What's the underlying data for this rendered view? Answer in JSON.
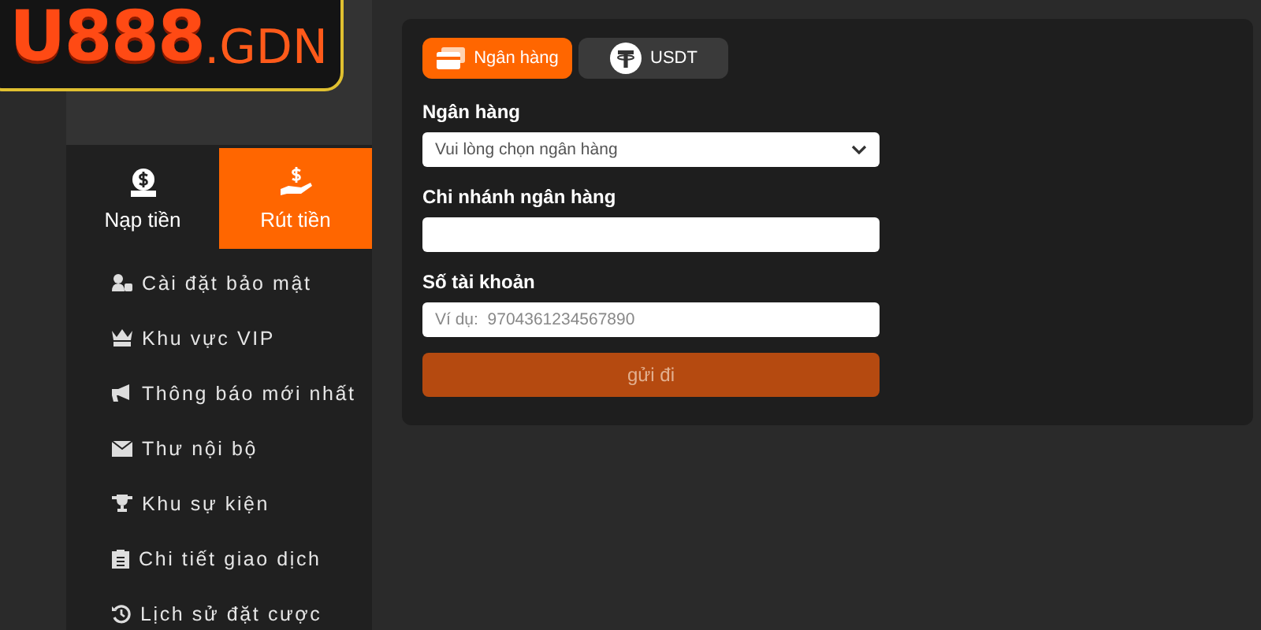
{
  "logo": {
    "main": "U888",
    "suffix": ".GDN"
  },
  "wallet_tabs": [
    {
      "label": "Nạp tiền",
      "kind": "deposit",
      "selected": false
    },
    {
      "label": "Rút tiền",
      "kind": "withdraw",
      "selected": true
    }
  ],
  "menu": [
    {
      "label": "Cài đặt bảo mật",
      "kind": "security"
    },
    {
      "label": "Khu vực VIP",
      "kind": "vip"
    },
    {
      "label": "Thông báo mới nhất",
      "kind": "news"
    },
    {
      "label": "Thư nội bộ",
      "kind": "mail"
    },
    {
      "label": "Khu sự kiện",
      "kind": "events"
    },
    {
      "label": "Chi tiết giao dịch",
      "kind": "transactions"
    },
    {
      "label": "Lịch sử đặt cược",
      "kind": "bets"
    }
  ],
  "method_tabs": [
    {
      "label": "Ngân hàng",
      "kind": "bank",
      "selected": true
    },
    {
      "label": "USDT",
      "kind": "crypto",
      "selected": false
    }
  ],
  "fields": [
    {
      "label": "Ngân hàng",
      "kind": "select",
      "placeholder": "Vui lòng chọn ngân hàng"
    },
    {
      "label": "Chi nhánh ngân hàng",
      "kind": "text"
    },
    {
      "label": "Số tài khoản",
      "kind": "text",
      "placeholder": "Ví dụ:  9704361234567890"
    }
  ],
  "submit": {
    "label": "gửi đi",
    "disabled": true
  }
}
